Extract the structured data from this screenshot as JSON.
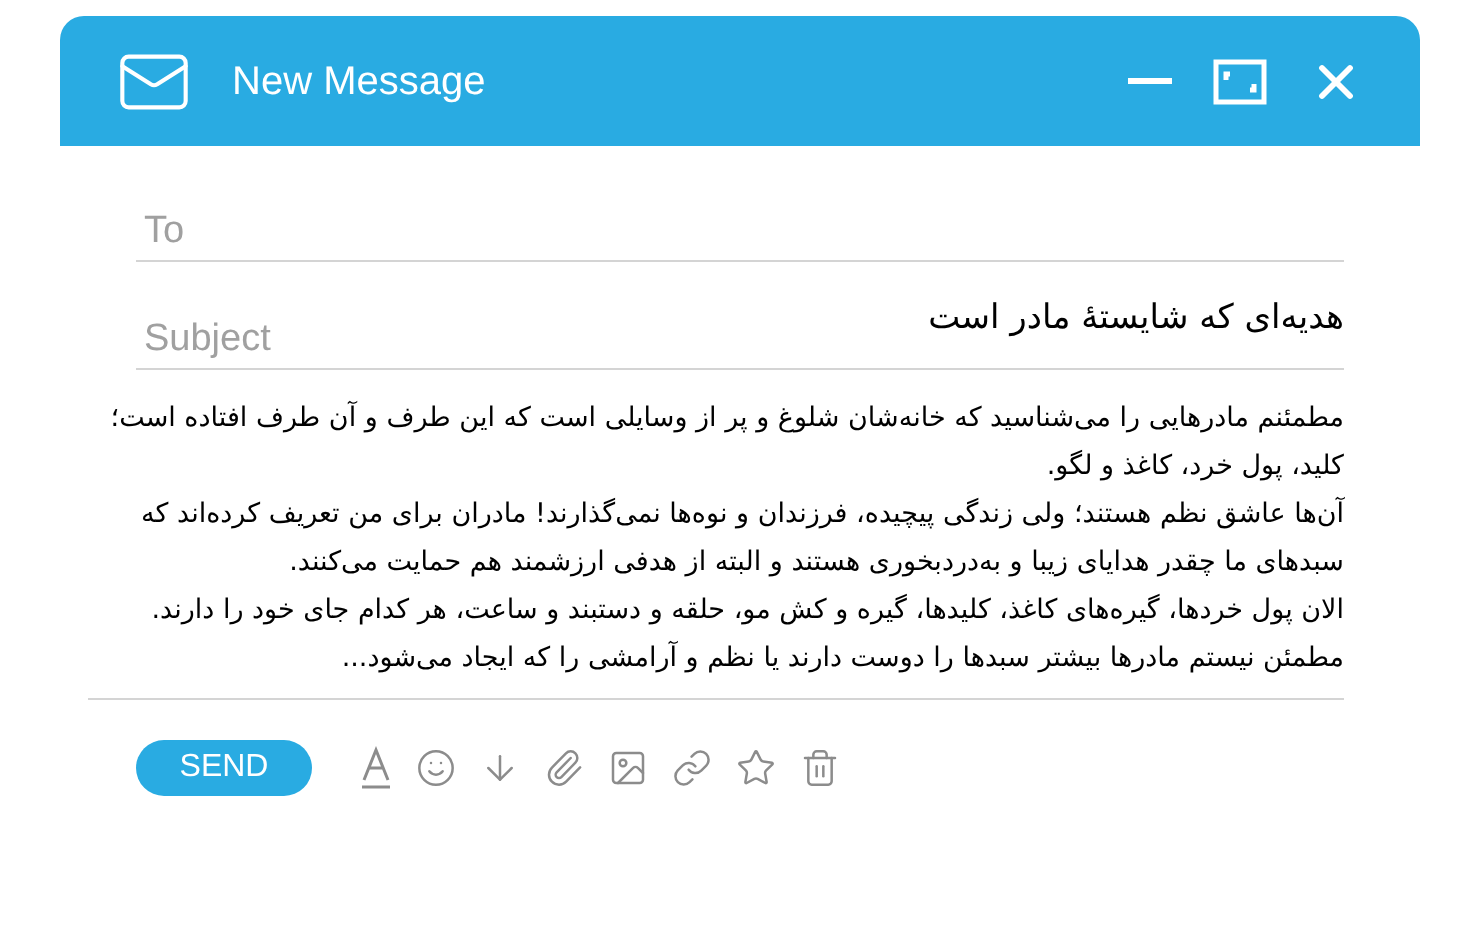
{
  "window": {
    "title": "New Message"
  },
  "to": {
    "placeholder": "To"
  },
  "subject": {
    "placeholder": "Subject",
    "value": "هدیه‌ای که شایستهٔ مادر است"
  },
  "body_lines": [
    "مطمئنم مادرهایی را می‌شناسید که خانه‌شان شلوغ و پر از وسایلی است که این طرف و آن طرف افتاده است؛",
    "کلید، پول خرد، کاغذ و لگو.",
    "آن‌ها عاشق نظم هستند؛ ولی زندگی پیچیده، فرزندان و نوه‌ها نمی‌گذارند! مادران برای من تعریف کرده‌اند که",
    "سبدهای ما چقدر هدایای زیبا و به‌دردبخوری هستند و البته از هدفی ارزشمند هم حمایت می‌کنند.",
    "الان پول خردها، گیره‌های کاغذ، کلیدها، گیره و کش مو، حلقه و دستبند و ساعت، هر کدام جای خود را دارند.",
    "مطمئن نیستم مادرها بیشتر سبدها را دوست دارند یا نظم و آرامشی را که ایجاد می‌شود..."
  ],
  "send_button": "SEND"
}
